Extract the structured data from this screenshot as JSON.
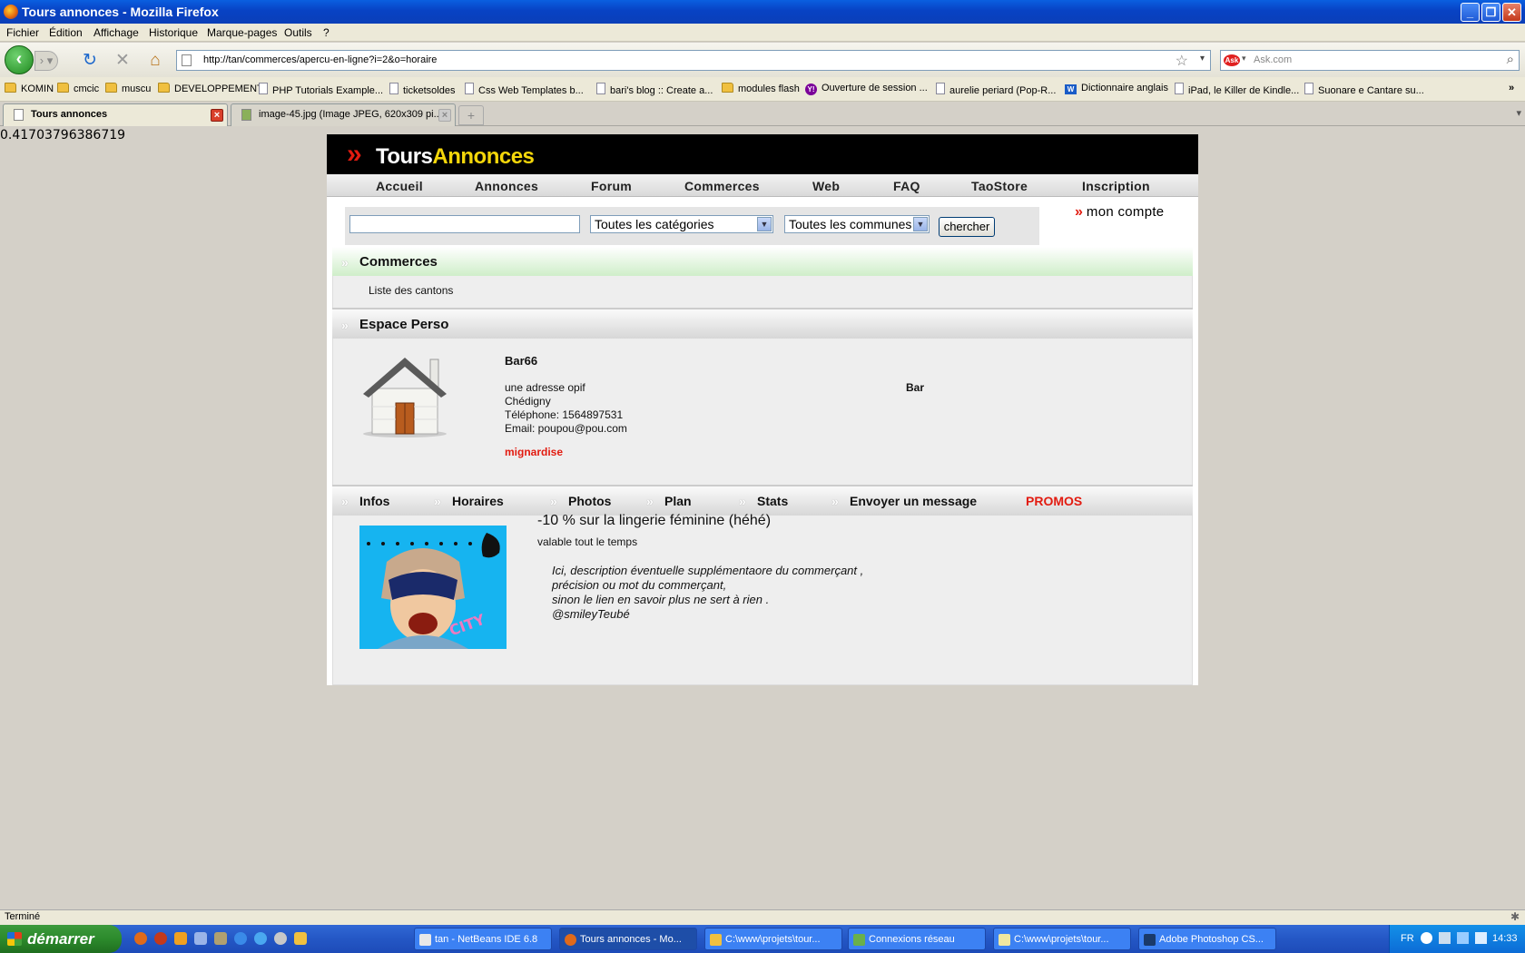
{
  "window": {
    "title": "Tours annonces - Mozilla Firefox"
  },
  "menu": [
    "Fichier",
    "Édition",
    "Affichage",
    "Historique",
    "Marque-pages",
    "Outils",
    "?"
  ],
  "nav": {
    "url": "http://tan/commerces/apercu-en-ligne?i=2&o=horaire",
    "search_placeholder": "Ask.com",
    "search_engine": "Ask"
  },
  "bookmarks": [
    {
      "label": "KOMIN",
      "icon": "folder"
    },
    {
      "label": "cmcic",
      "icon": "folder"
    },
    {
      "label": "muscu",
      "icon": "folder"
    },
    {
      "label": "DEVELOPPEMENT",
      "icon": "folder"
    },
    {
      "label": "PHP Tutorials Example...",
      "icon": "page"
    },
    {
      "label": "ticketsoldes",
      "icon": "page"
    },
    {
      "label": "Css Web Templates b...",
      "icon": "page"
    },
    {
      "label": "bari's blog :: Create a...",
      "icon": "page"
    },
    {
      "label": "modules flash",
      "icon": "folder"
    },
    {
      "label": "Ouverture de session ...",
      "icon": "yahoo"
    },
    {
      "label": "aurelie periard (Pop-R...",
      "icon": "page"
    },
    {
      "label": "Dictionnaire anglais",
      "icon": "wr"
    },
    {
      "label": "iPad, le Killer de Kindle...",
      "icon": "page"
    },
    {
      "label": "Suonare e Cantare su...",
      "icon": "page"
    }
  ],
  "tabs": [
    {
      "label": "Tours annonces"
    },
    {
      "label": "image-45.jpg (Image JPEG, 620x309 pi..."
    }
  ],
  "debug_value": "0.41703796386719",
  "site": {
    "logo_tours": "Tours",
    "logo_annonces": "Annonces",
    "nav": [
      "Accueil",
      "Annonces",
      "Forum",
      "Commerces",
      "Web",
      "FAQ",
      "TaoStore",
      "Inscription"
    ],
    "search": {
      "category": "Toutes les catégories",
      "commune": "Toutes les communes",
      "button": "chercher"
    },
    "mon_compte": "mon compte",
    "commerces_title": "Commerces",
    "cantons_link": "Liste des cantons",
    "espace_title": "Espace Perso",
    "shop": {
      "name": "Bar66",
      "address": "une adresse opif",
      "city": "Chédigny",
      "phone": "Téléphone: 1564897531",
      "email": "Email: poupou@pou.com",
      "tag": "mignardise",
      "type": "Bar"
    },
    "tabs": [
      "Infos",
      "Horaires",
      "Photos",
      "Plan",
      "Stats",
      "Envoyer un message"
    ],
    "promos_label": "PROMOS",
    "promo": {
      "title": "-10 % sur la lingerie féminine (héhé)",
      "validity": "valable tout le temps",
      "desc": [
        "Ici, description éventuelle supplémentaore du commerçant ,",
        "précision ou mot du commerçant,",
        "sinon le lien en savoir plus ne sert à rien .",
        "@smileyTeubé"
      ]
    },
    "colors": {
      "accent_red": "#e21b10",
      "logo_yellow": "#f5d70a",
      "promo_red": "#e21b10"
    }
  },
  "status": {
    "text": "Terminé"
  },
  "taskbar": {
    "start": "démarrer",
    "tasks": [
      "tan - NetBeans IDE 6.8",
      "Tours annonces - Mo...",
      "C:\\www\\projets\\tour...",
      "Connexions réseau",
      "C:\\www\\projets\\tour...",
      "Adobe Photoshop CS..."
    ],
    "lang": "FR",
    "clock": "14:33"
  }
}
